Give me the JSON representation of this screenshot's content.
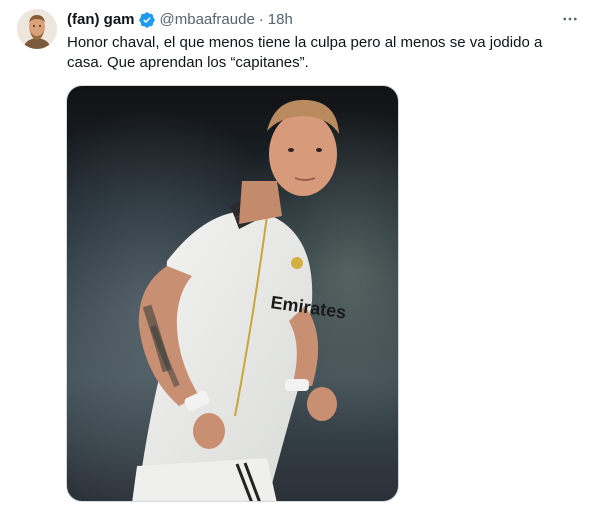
{
  "tweet": {
    "author": {
      "display_name": "(fan) gam",
      "handle": "@mbaafraude",
      "verified": true,
      "avatar_icon": "avatar-photo"
    },
    "separator": "·",
    "timestamp": "18h",
    "text": "Honor chaval, el que menos tiene la culpa pero al menos se va jodido a casa. Que aprendan los “capitanes”.",
    "more_icon": "more-horizontal-icon",
    "media": {
      "kind": "photo",
      "jersey_sponsor": "Emirates"
    }
  },
  "colors": {
    "primary_text": "#0f1419",
    "secondary_text": "#536471",
    "verified_badge": "#1d9bf0",
    "media_border": "#cfd9de"
  }
}
